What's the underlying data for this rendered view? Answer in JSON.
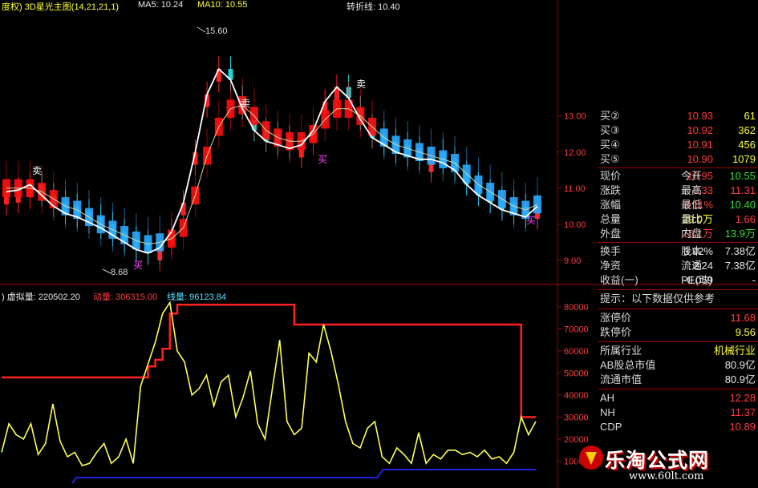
{
  "header": {
    "indicator": "度权) 3D星光主图(14,21,21,1)",
    "ma5": "MA5: 10.24",
    "ma10": "MA10: 10.55",
    "turn": "转折线: 10.40"
  },
  "sub_header": {
    "virtual": ") 虚拟量: 220502.20",
    "dynamic": "动量: 306315.00",
    "line": "线量: 96123.84"
  },
  "price_annotations": {
    "high": "15.60",
    "low": "8.68",
    "sell": "卖",
    "buy": "买"
  },
  "colors": {
    "up": "#ff2020",
    "down": "#22d6d6",
    "ribbon_up": "#ff1010",
    "ribbon_down": "#2aaaff",
    "ma_white": "#ffffff",
    "volume": "#ffff55",
    "dynamic": "#ff2020",
    "baseline": "#2222dd"
  },
  "chart_data": [
    {
      "type": "line",
      "title": "3D星光主图",
      "y_ticks": [
        "13.00",
        "12.00",
        "11.00",
        "10.00",
        "9.00"
      ],
      "ylim": [
        8.4,
        15.9
      ],
      "series": [
        {
          "name": "MA5",
          "values": [
            10.9,
            10.95,
            11.1,
            10.8,
            10.5,
            10.3,
            10.2,
            10.05,
            9.9,
            9.7,
            9.5,
            9.3,
            9.2,
            9.35,
            9.8,
            10.6,
            12.0,
            13.6,
            14.3,
            14.0,
            13.2,
            12.6,
            12.3,
            12.2,
            12.1,
            12.2,
            12.6,
            13.4,
            13.8,
            13.5,
            12.9,
            12.4,
            12.2,
            12.0,
            11.9,
            11.8,
            11.8,
            11.7,
            11.5,
            11.1,
            10.8,
            10.6,
            10.4,
            10.3,
            10.2,
            10.5
          ]
        },
        {
          "name": "MA10",
          "values": [
            11.0,
            11.0,
            11.0,
            10.9,
            10.7,
            10.5,
            10.4,
            10.2,
            10.0,
            9.85,
            9.7,
            9.55,
            9.45,
            9.5,
            9.6,
            9.9,
            10.8,
            11.9,
            12.7,
            13.2,
            13.3,
            13.0,
            12.6,
            12.4,
            12.3,
            12.3,
            12.5,
            12.9,
            13.2,
            13.2,
            13.0,
            12.7,
            12.4,
            12.2,
            12.1,
            12.0,
            11.9,
            11.8,
            11.7,
            11.4,
            11.1,
            10.9,
            10.7,
            10.5,
            10.4,
            10.55
          ]
        }
      ]
    },
    {
      "type": "line",
      "title": "虚拟量",
      "y_ticks": [
        "80000",
        "70000",
        "60000",
        "50000",
        "40000",
        "30000",
        "20000",
        "10000"
      ],
      "ylim": [
        0,
        84000
      ],
      "series": [
        {
          "name": "虚拟量",
          "values": [
            14000,
            27000,
            22000,
            20000,
            27000,
            13000,
            18000,
            36000,
            19000,
            12000,
            14000,
            8000,
            9000,
            14000,
            18000,
            9000,
            12000,
            20000,
            9000,
            44000,
            54000,
            64000,
            77000,
            82000,
            60000,
            55000,
            40000,
            43000,
            49000,
            35000,
            46000,
            49000,
            30000,
            39000,
            51000,
            27000,
            20000,
            43000,
            65000,
            28000,
            22000,
            25000,
            59000,
            55000,
            72000,
            60000,
            45000,
            28000,
            18000,
            16000,
            25000,
            28000,
            12000,
            9000,
            16000,
            13000,
            9000,
            23000,
            9000,
            13000,
            11000,
            15000,
            15000,
            13000,
            14000,
            12000,
            15000,
            11000,
            12000,
            9000,
            14000,
            30000,
            22000,
            28000
          ]
        },
        {
          "name": "动量",
          "values": [
            48000,
            48000,
            48000,
            48000,
            48000,
            48000,
            48000,
            48000,
            48000,
            48000,
            48000,
            48000,
            48000,
            48000,
            48000,
            48000,
            48000,
            48000,
            48000,
            48000,
            53000,
            56000,
            61000,
            77000,
            81000,
            81000,
            81000,
            81000,
            81000,
            81000,
            81000,
            81000,
            81000,
            81000,
            81000,
            81000,
            81000,
            81000,
            81000,
            81000,
            72000,
            72000,
            72000,
            72000,
            72000,
            72000,
            72000,
            72000,
            72000,
            72000,
            72000,
            72000,
            72000,
            72000,
            72000,
            72000,
            72000,
            72000,
            72000,
            72000,
            72000,
            72000,
            72000,
            72000,
            72000,
            72000,
            72000,
            72000,
            72000,
            72000,
            72000,
            30000,
            30000,
            30000
          ]
        }
      ]
    }
  ],
  "quote_panel": {
    "bids": [
      {
        "label": "买②",
        "price": "10.93",
        "vol": "61"
      },
      {
        "label": "买③",
        "price": "10.92",
        "vol": "362"
      },
      {
        "label": "买④",
        "price": "10.91",
        "vol": "456"
      },
      {
        "label": "买⑤",
        "price": "10.90",
        "vol": "1079"
      }
    ],
    "stats": [
      {
        "l1": "现价",
        "v1": "10.95",
        "c1": "red",
        "l2": "今开",
        "v2": "10.55",
        "c2": "green"
      },
      {
        "l1": "涨跌",
        "v1": "0.33",
        "c1": "red",
        "l2": "最高",
        "v2": "11.31",
        "c2": "red"
      },
      {
        "l1": "涨幅",
        "v1": "3.11%",
        "c1": "red",
        "l2": "最低",
        "v2": "10.40",
        "c2": "green"
      },
      {
        "l1": "总量",
        "v1": "29.0万",
        "c1": "yellow",
        "l2": "量比",
        "v2": "1.66",
        "c2": "red"
      },
      {
        "l1": "外盘",
        "v1": "15.1万",
        "c1": "red",
        "l2": "内盘",
        "v2": "13.9万",
        "c2": "green"
      }
    ],
    "fundamentals": [
      {
        "l1": "换手",
        "v1": "3.92%",
        "l2": "股本",
        "v2": "7.38亿"
      },
      {
        "l1": "净资",
        "v1": "2.24",
        "l2": "流通",
        "v2": "7.38亿"
      },
      {
        "l1": "收益(一)",
        "v1": "-0.059",
        "l2": "PE(动)",
        "v2": "-"
      }
    ],
    "tip": "提示：以下数据仅供参考",
    "limit_up_label": "涨停价",
    "limit_up": "11.68",
    "limit_down_label": "跌停价",
    "limit_down": "9.56",
    "industry_label": "所属行业",
    "industry": "机械行业",
    "ab_cap_label": "AB股总市值",
    "ab_cap": "80.9亿",
    "float_cap_label": "流通市值",
    "float_cap": "80.9亿",
    "ah_label": "AH",
    "ah": "12.28",
    "nh_label": "NH",
    "nh": "11.37",
    "cdp_label": "CDP",
    "cdp": "10.89"
  },
  "watermark": {
    "title": "乐淘公式网",
    "url": "www.60lt.com"
  }
}
